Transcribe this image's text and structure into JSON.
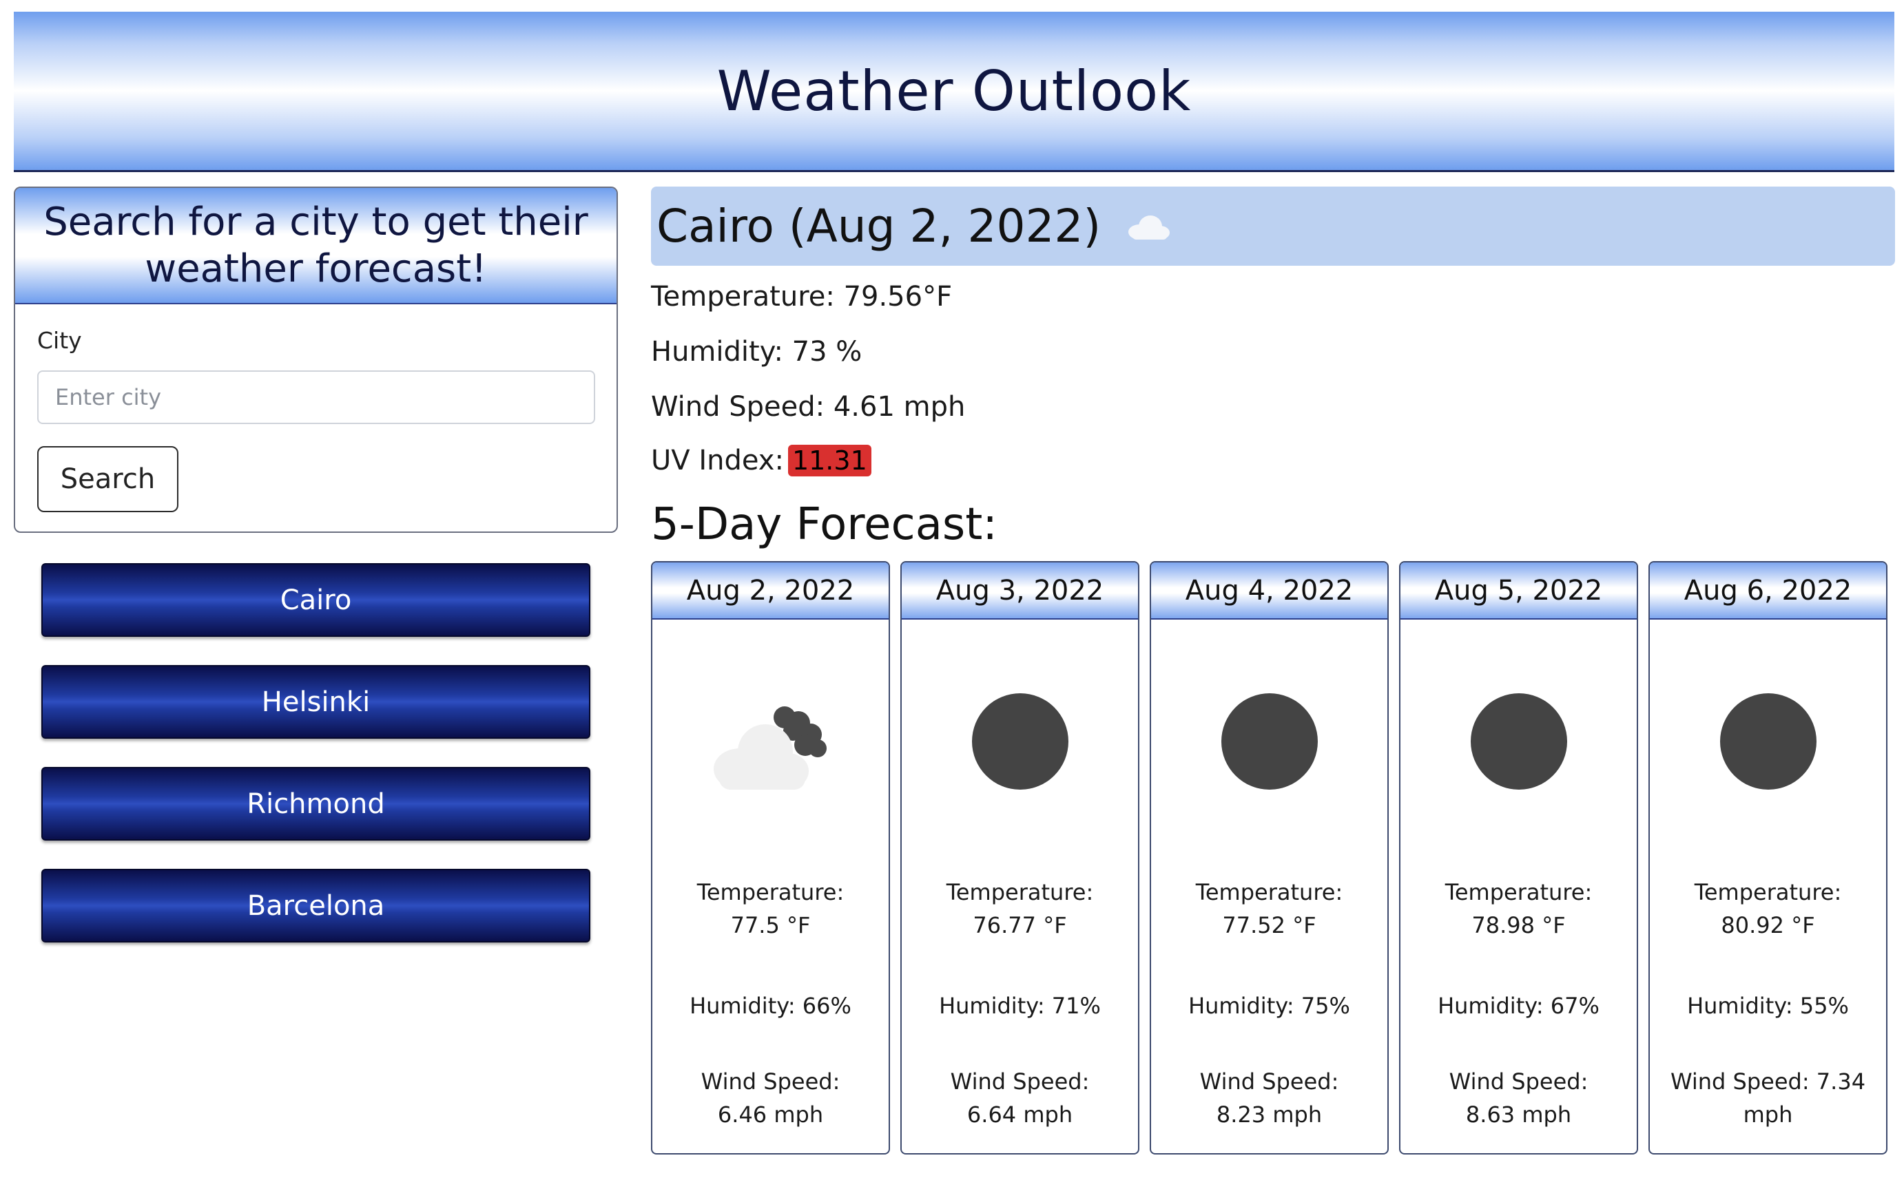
{
  "header": {
    "title": "Weather Outlook"
  },
  "search": {
    "heading": "Search for a city to get their weather forecast!",
    "city_label": "City",
    "placeholder": "Enter city",
    "value": "",
    "button_label": "Search"
  },
  "history": [
    "Cairo",
    "Helsinki",
    "Richmond",
    "Barcelona"
  ],
  "current": {
    "title": "Cairo (Aug 2, 2022)",
    "icon": "cloud-icon",
    "temperature": "Temperature: 79.56°F",
    "humidity": "Humidity: 73 %",
    "wind": "Wind Speed: 4.61 mph",
    "uv_label": "UV Index:",
    "uv_value": "11.31",
    "uv_color": "#d9302f"
  },
  "forecast_title": "5-Day Forecast:",
  "forecast": [
    {
      "date": "Aug 2, 2022",
      "icon": "cloud-night-icon",
      "temp_label": "Temperature:",
      "temp": "77.5 °F",
      "humidity": "Humidity: 66%",
      "wind_label": "Wind Speed:",
      "wind": "6.46 mph"
    },
    {
      "date": "Aug 3, 2022",
      "icon": "clear-night-icon",
      "temp_label": "Temperature:",
      "temp": "76.77 °F",
      "humidity": "Humidity: 71%",
      "wind_label": "Wind Speed:",
      "wind": "6.64 mph"
    },
    {
      "date": "Aug 4, 2022",
      "icon": "clear-night-icon",
      "temp_label": "Temperature:",
      "temp": "77.52 °F",
      "humidity": "Humidity: 75%",
      "wind_label": "Wind Speed:",
      "wind": "8.23 mph"
    },
    {
      "date": "Aug 5, 2022",
      "icon": "clear-night-icon",
      "temp_label": "Temperature:",
      "temp": "78.98 °F",
      "humidity": "Humidity: 67%",
      "wind_label": "Wind Speed:",
      "wind": "8.63 mph"
    },
    {
      "date": "Aug 6, 2022",
      "icon": "clear-night-icon",
      "temp_label": "Temperature:",
      "temp": "80.92 °F",
      "humidity": "Humidity: 55%",
      "wind_label": "Wind Speed: 7.34",
      "wind": "mph"
    }
  ],
  "colors": {
    "accent_blue": "#6f9eee",
    "navy": "#0f1640",
    "banner": "#bcd1f1"
  }
}
